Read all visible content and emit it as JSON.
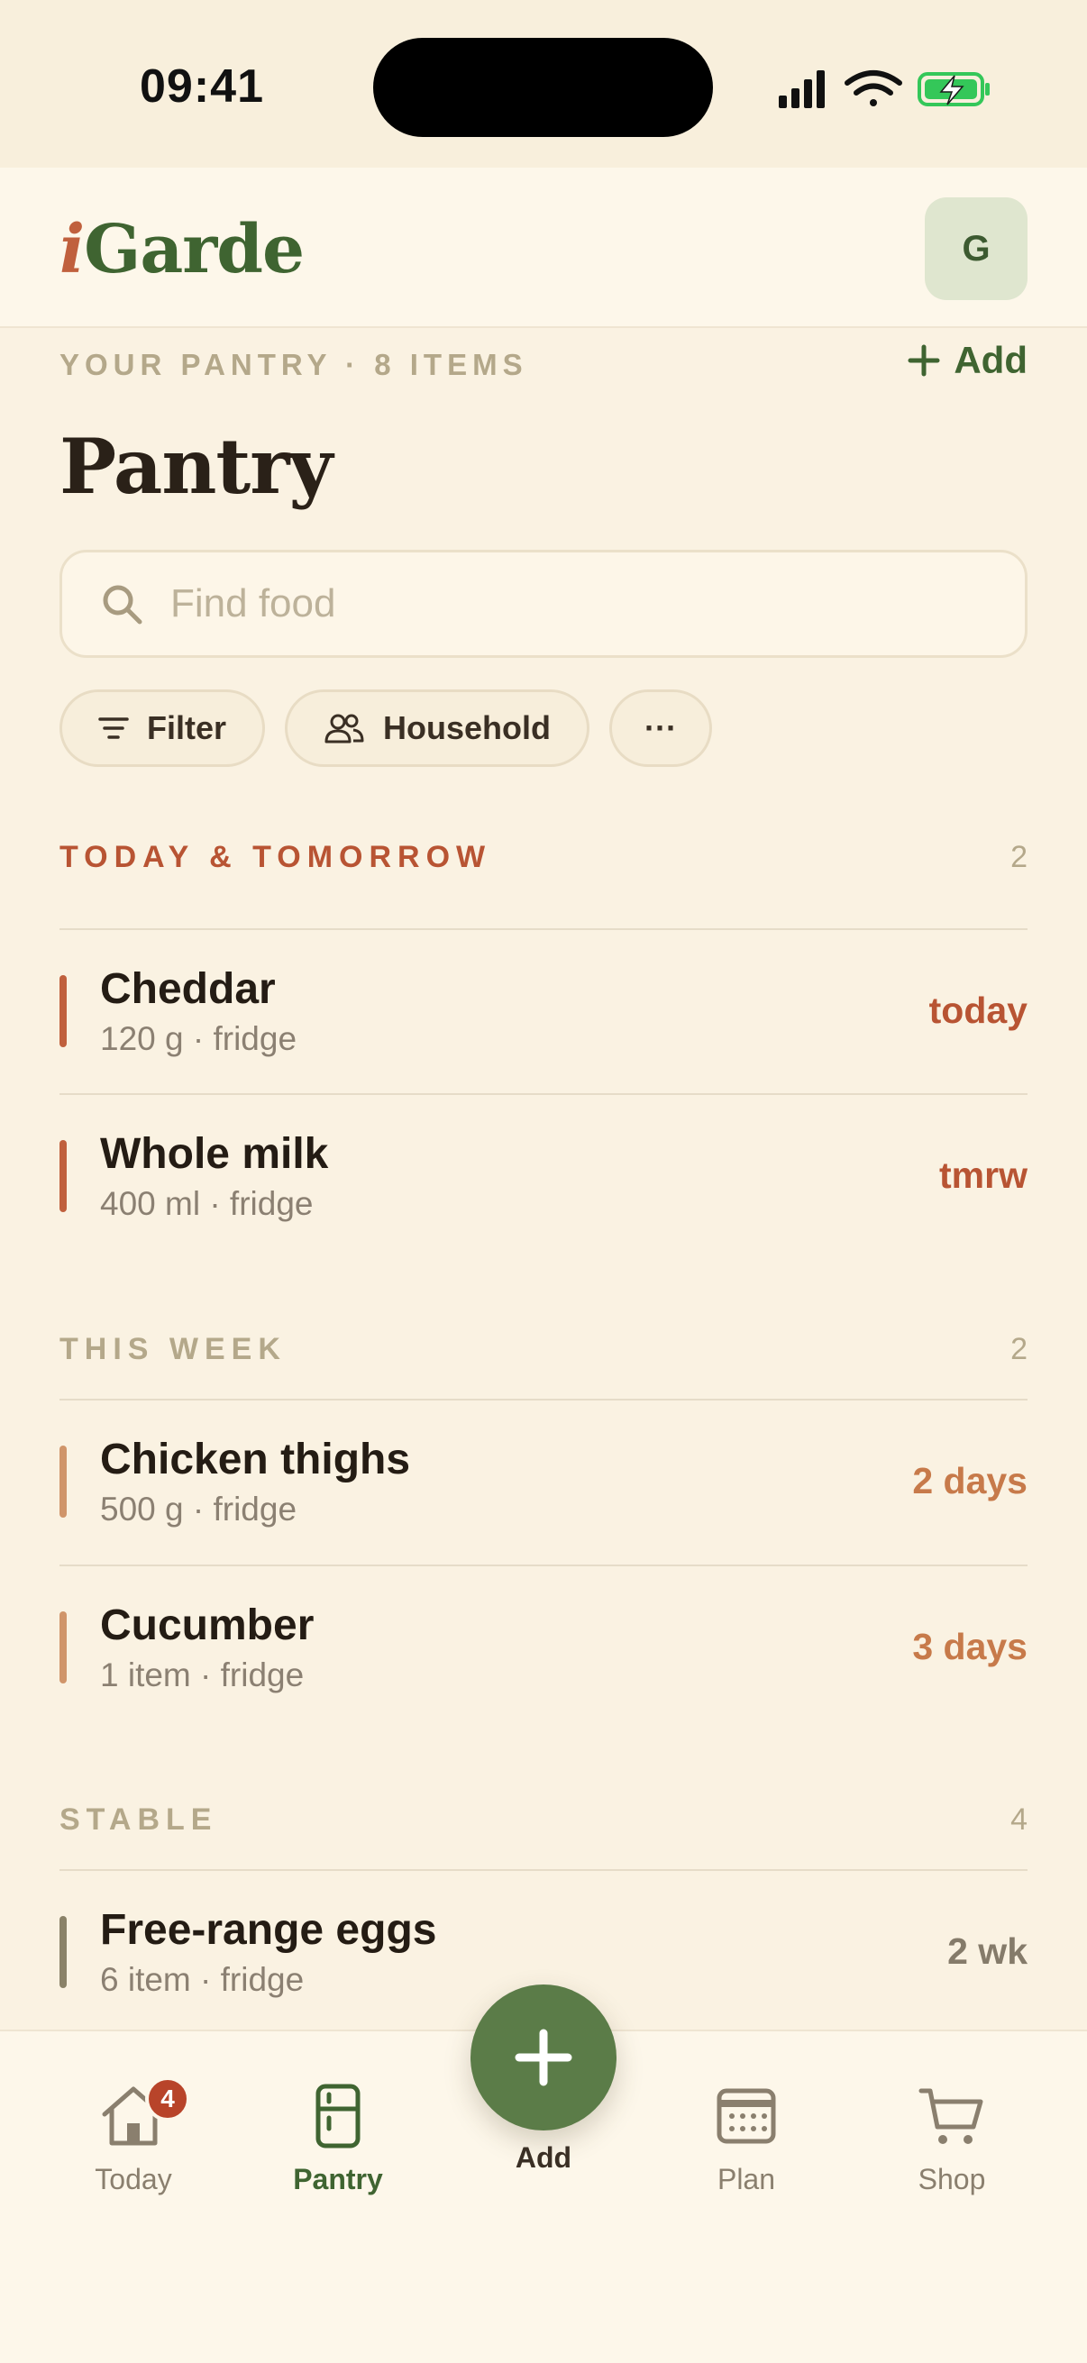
{
  "status_bar": {
    "time": "09:41"
  },
  "header": {
    "logo_prefix": "i",
    "logo_rest": "Garde",
    "avatar_initial": "G"
  },
  "pantry": {
    "eyebrow": "YOUR PANTRY · 8 ITEMS",
    "add_label": "Add",
    "title": "Pantry"
  },
  "search": {
    "placeholder": "Find food",
    "value": ""
  },
  "chips": {
    "filter": "Filter",
    "household": "Household",
    "more": "···"
  },
  "groups": [
    {
      "label": "TODAY & TOMORROW",
      "count": "2",
      "color": "#b85433",
      "items": [
        {
          "name": "Cheddar",
          "meta": "120 g · fridge",
          "due": "today",
          "accent": "#c0603d"
        },
        {
          "name": "Whole milk",
          "meta": "400 ml · fridge",
          "due": "tmrw",
          "accent": "#c0603d"
        }
      ]
    },
    {
      "label": "THIS WEEK",
      "count": "2",
      "color": "#b4a88a",
      "items": [
        {
          "name": "Chicken thighs",
          "meta": "500 g · fridge",
          "due": "2 days",
          "accent": "#d0956a"
        },
        {
          "name": "Cucumber",
          "meta": "1 item · fridge",
          "due": "3 days",
          "accent": "#d0956a"
        }
      ]
    },
    {
      "label": "STABLE",
      "count": "4",
      "color": "#b4a88a",
      "items": [
        {
          "name": "Free-range eggs",
          "meta": "6 item · fridge",
          "due": "2 wk",
          "accent": "#8a8268"
        }
      ]
    }
  ],
  "nav": {
    "today": "Today",
    "today_badge": "4",
    "pantry": "Pantry",
    "add": "Add",
    "plan": "Plan",
    "shop": "Shop"
  },
  "colors": {
    "brand_green": "#3f6431",
    "brand_terracotta": "#c0603d",
    "background": "#faf2e2",
    "fab": "#5b7c48",
    "week_due": "#c77a4a",
    "stable_due": "#857b6a"
  }
}
